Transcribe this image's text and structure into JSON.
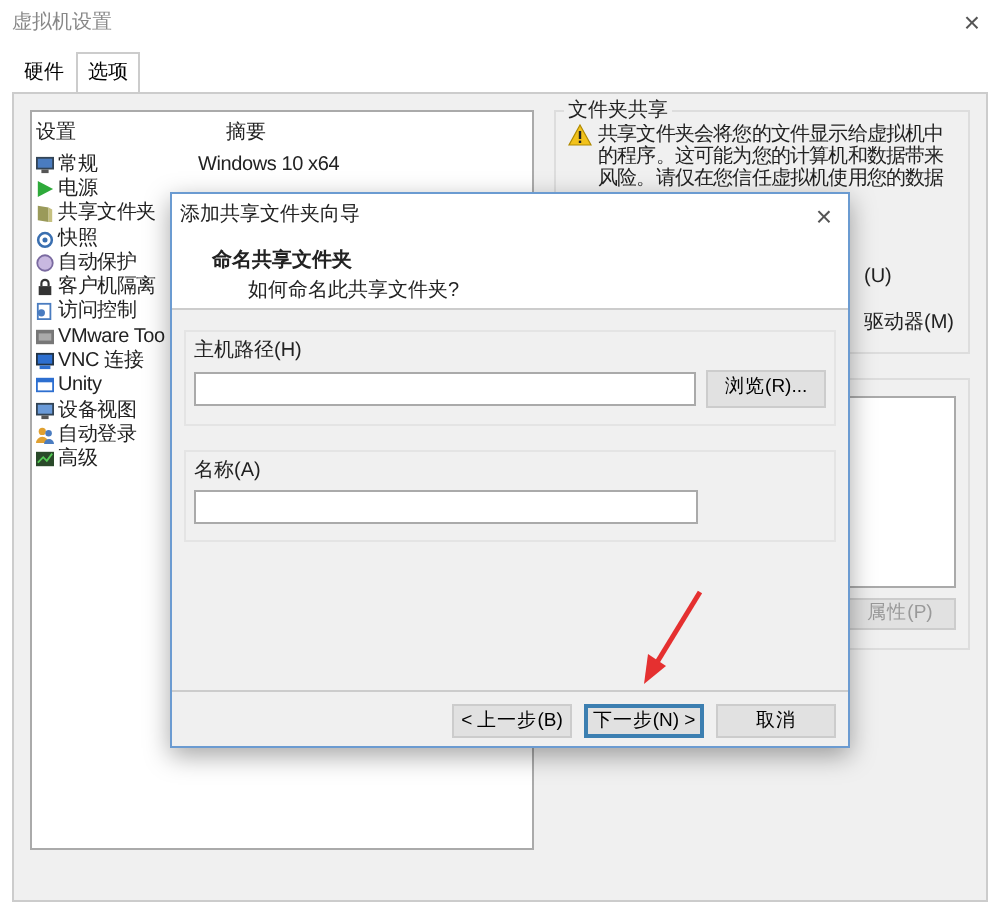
{
  "window": {
    "title": "虚拟机设置",
    "close": "×"
  },
  "tabs": [
    {
      "label": "硬件",
      "selected": false
    },
    {
      "label": "选项",
      "selected": true
    }
  ],
  "settings_list": {
    "columns": [
      "设置",
      "摘要"
    ],
    "items": [
      {
        "label": "常规",
        "summary": "Windows 10 x64"
      },
      {
        "label": "电源"
      },
      {
        "label": "共享文件夹"
      },
      {
        "label": "快照"
      },
      {
        "label": "自动保护"
      },
      {
        "label": "客户机隔离"
      },
      {
        "label": "访问控制"
      },
      {
        "label": "VMware Too"
      },
      {
        "label": "VNC 连接"
      },
      {
        "label": "Unity"
      },
      {
        "label": "设备视图"
      },
      {
        "label": "自动登录"
      },
      {
        "label": "高级"
      }
    ]
  },
  "folder_sharing": {
    "title": "文件夹共享",
    "warning_lines": [
      "共享文件夹会将您的文件显示给虚拟机中",
      "的程序。这可能为您的计算机和数据带来",
      "风险。请仅在您信任虚拟机使用您的数据"
    ],
    "option_1": "(U)",
    "option_2": "驱动器(M)",
    "properties_button": {
      "label": "属性(P)",
      "disabled": true
    }
  },
  "dialog": {
    "title": "添加共享文件夹向导",
    "close": "×",
    "heading": "命名共享文件夹",
    "subheading": "如何命名此共享文件夹?",
    "host_path": {
      "label": "主机路径(H)",
      "browse": "浏览(R)..."
    },
    "name": {
      "label": "名称(A)"
    },
    "buttons": [
      {
        "label": "< 上一步(B)",
        "focused": false
      },
      {
        "label": "下一步(N) >",
        "focused": true
      },
      {
        "label": "取消",
        "focused": false
      }
    ]
  }
}
